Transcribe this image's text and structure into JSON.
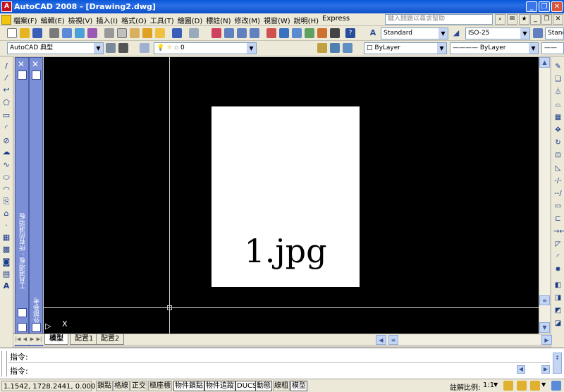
{
  "window": {
    "app_icon": "autocad-logo-icon",
    "title": "AutoCAD 2008 - [Drawing2.dwg]"
  },
  "menu": {
    "items": [
      "檔案(F)",
      "編輯(E)",
      "檢視(V)",
      "插入(I)",
      "格式(O)",
      "工具(T)",
      "繪圖(D)",
      "標註(N)",
      "修改(M)",
      "視窗(W)",
      "說明(H)",
      "Express"
    ],
    "help_placeholder": "鍵入問題以尋求幫助"
  },
  "toolbar": {
    "text_style": "Standard",
    "dim_style": "ISO-25",
    "table_style": "Standa",
    "workspace": "AutoCAD 典型",
    "layer": "0",
    "color": "ByLayer",
    "linetype": "ByLayer"
  },
  "palettes": {
    "tool_palette_title": "工具選項板 - 所有的選項板",
    "xref_title": "外部參考"
  },
  "drawing": {
    "image_label": "1.jpg",
    "ucs_x": "X"
  },
  "layout_tabs": [
    "模型",
    "配置1",
    "配置2"
  ],
  "command": {
    "history": "指令:",
    "prompt": "指令:"
  },
  "status": {
    "coords": "1.1542, 1728.2441, 0.0000",
    "toggles": [
      {
        "label": "鎖點",
        "on": false
      },
      {
        "label": "格線",
        "on": false
      },
      {
        "label": "正交",
        "on": false
      },
      {
        "label": "極座標",
        "on": false
      },
      {
        "label": "物件鎖點",
        "on": true
      },
      {
        "label": "物件追蹤",
        "on": true
      },
      {
        "label": "DUCS",
        "on": true
      },
      {
        "label": "動態",
        "on": true
      },
      {
        "label": "線粗",
        "on": false
      },
      {
        "label": "模型",
        "on": true
      }
    ],
    "annotation_scale_label": "註解比例:",
    "annotation_scale_value": "1:1"
  }
}
